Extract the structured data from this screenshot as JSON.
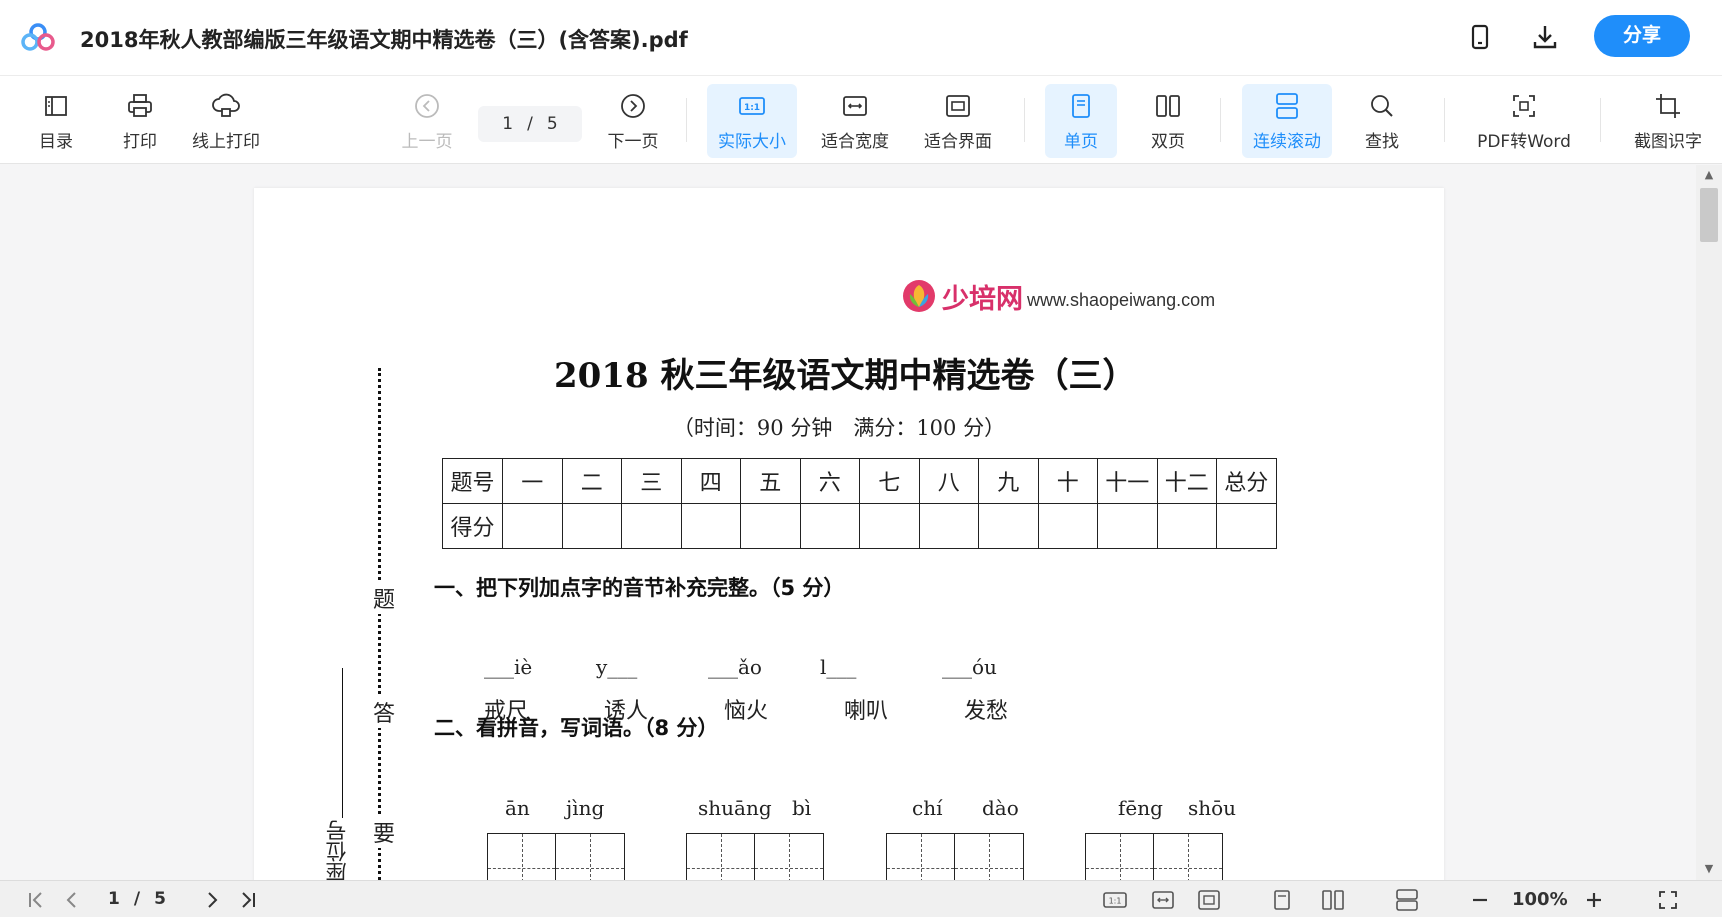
{
  "header": {
    "title": "2018年秋人教部编版三年级语文期中精选卷（三）(含答案).pdf",
    "share_label": "分享",
    "accent_color": "#1f8efa"
  },
  "toolbar": {
    "toc_label": "目录",
    "print_label": "打印",
    "online_print_label": "线上打印",
    "prev_label": "上一页",
    "current_page": "1",
    "page_sep": "/",
    "total_pages": "5",
    "next_label": "下一页",
    "actual_size_label": "实际大小",
    "fit_width_label": "适合宽度",
    "fit_page_label": "适合界面",
    "single_label": "单页",
    "double_label": "双页",
    "continuous_label": "连续滚动",
    "search_label": "查找",
    "pdf2word_label": "PDF转Word",
    "ocr_label": "截图识字"
  },
  "document": {
    "brand_cn": "少培网",
    "brand_url": "www.shaopeiwang.com",
    "title": "2018 秋三年级语文期中精选卷（三）",
    "subtitle": "（时间：90 分钟　满分：100 分）",
    "score_table": {
      "header_row": [
        "题号",
        "一",
        "二",
        "三",
        "四",
        "五",
        "六",
        "七",
        "八",
        "九",
        "十",
        "十一",
        "十二",
        "总分"
      ],
      "second_row_label": "得分"
    },
    "section1": "一、把下列加点字的音节补充完整。（5 分）",
    "pinyin_blanks": [
      "___iè",
      "y___",
      "___ǎo",
      "l___",
      "___óu"
    ],
    "words": [
      "戒尺",
      "诱人",
      "恼火",
      "喇叭",
      "发愁"
    ],
    "section2": "二、看拼音，写词语。（8 分）",
    "pinyin_pairs": [
      [
        "ān",
        "jìng"
      ],
      [
        "shuāng",
        "bì"
      ],
      [
        "chí",
        "dào"
      ],
      [
        "fēng",
        "shōu"
      ]
    ],
    "side_chars": [
      "题",
      "答",
      "要"
    ],
    "seat_label": "座位号"
  },
  "bottom": {
    "current_page": "1",
    "page_sep": "/",
    "total_pages": "5",
    "zoom": "100%"
  }
}
